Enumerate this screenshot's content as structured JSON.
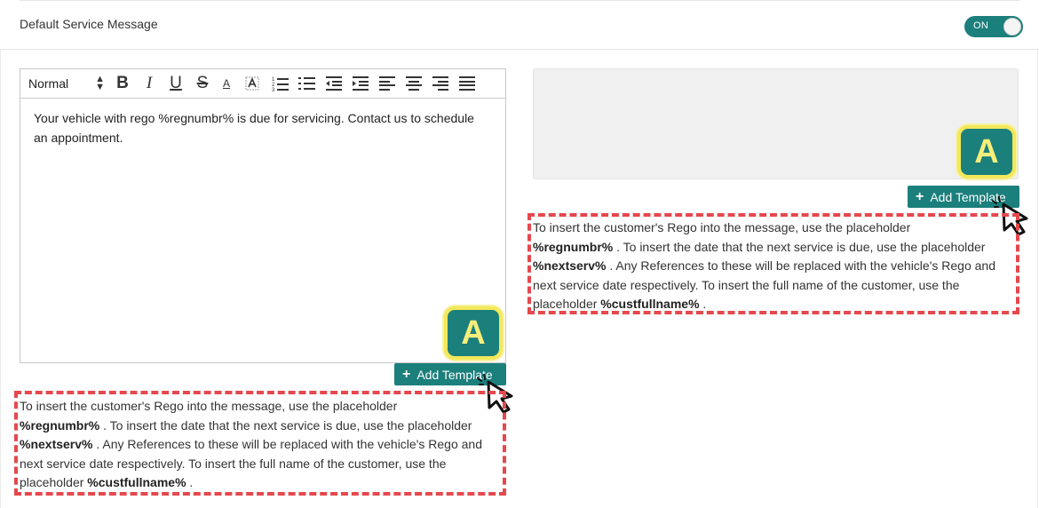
{
  "header": {
    "title": "Default Service Message",
    "toggle_label": "ON"
  },
  "editor": {
    "format_select": "Normal",
    "toolbar": {
      "bold": "B",
      "italic": "I",
      "underline": "U",
      "strike": "S",
      "font_color": "A"
    },
    "body_text": "Your vehicle with rego %regnumbr% is due for servicing. Contact us to schedule an appointment."
  },
  "badge_letter": "A",
  "add_template_label": "Add Template",
  "help": {
    "p1": "To insert the customer's Rego into the message, use the placeholder",
    "ph1": "%regnumbr%",
    "p2": " . To insert the date that the next service is due, use the placeholder ",
    "ph2": "%nextserv%",
    "p3": " . Any References to these will be replaced with the vehicle's Rego and next service date respectively. To insert the full name of the customer, use the placeholder ",
    "ph3": "%custfullname%",
    "p4": " ."
  },
  "colors": {
    "accent": "#1b7f7c",
    "badge_ring": "#f2e85a",
    "dashed_border": "#e5484d"
  }
}
